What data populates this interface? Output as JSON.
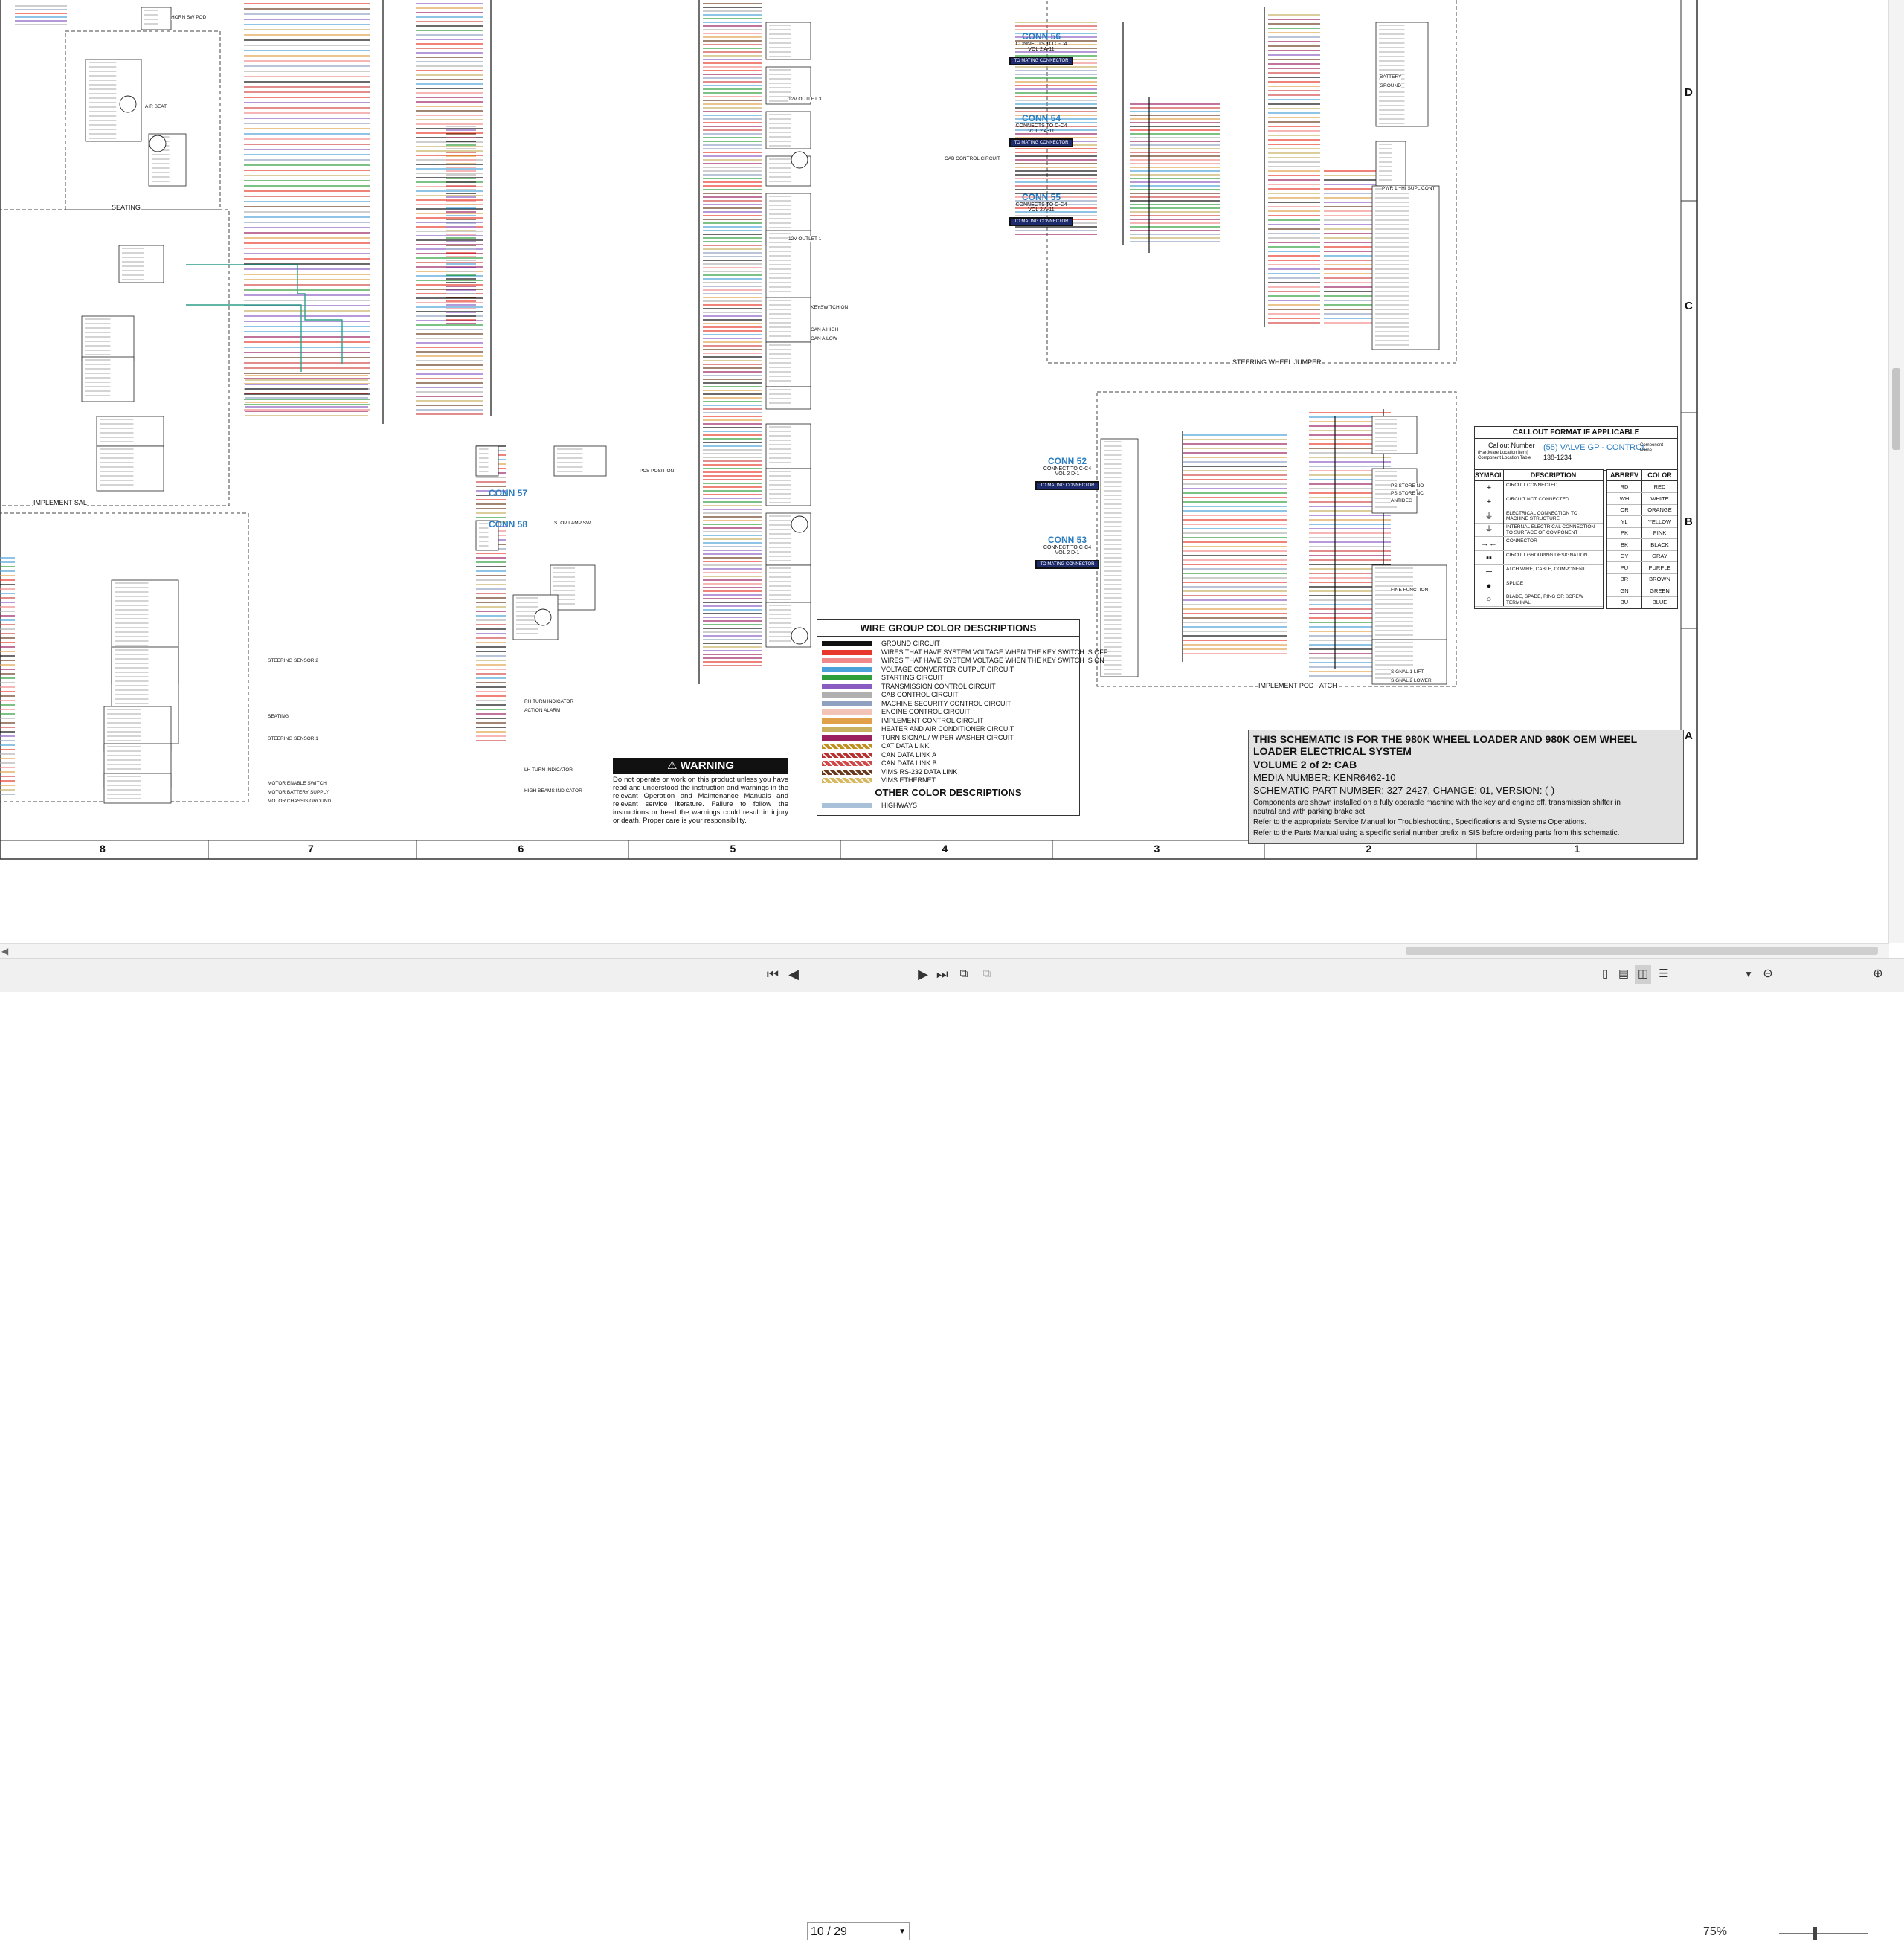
{
  "toolbar": {
    "page_current": "10",
    "page_total": "29",
    "page_display": "10 / 29",
    "zoom": "75%",
    "first_icon": "first-page-icon",
    "prev_icon": "previous-page-icon",
    "next_icon": "next-page-icon",
    "last_icon": "last-page-icon"
  },
  "connectors": [
    {
      "name": "CONN 56",
      "text": "CONNECTS TO C-C4",
      "vol": "VOL 2 A-11",
      "badge": "TO MATING CONNECTOR"
    },
    {
      "name": "CONN 54",
      "text": "CONNECTS TO C-C4",
      "vol": "VOL 2 A-11",
      "badge": "TO MATING CONNECTOR"
    },
    {
      "name": "CONN 55",
      "text": "CONNECTS TO C-C4",
      "vol": "VOL 2 A-11",
      "badge": "TO MATING CONNECTOR"
    },
    {
      "name": "CONN 52",
      "text": "CONNECT TO C-C4",
      "vol": "VOL 2 D-1",
      "badge": "TO MATING CONNECTOR"
    },
    {
      "name": "CONN 53",
      "text": "CONNECT TO C-C4",
      "vol": "VOL 2 D-1",
      "badge": "TO MATING CONNECTOR"
    },
    {
      "name": "CONN 57",
      "text": "",
      "vol": "",
      "badge": ""
    },
    {
      "name": "CONN 58",
      "text": "",
      "vol": "",
      "badge": ""
    }
  ],
  "section_labels": {
    "seating": "SEATING",
    "implement_sal": "IMPLEMENT SAL",
    "steering_wheel_jumper": "STEERING WHEEL JUMPER",
    "implement_pod": "IMPLEMENT POD - ATCH"
  },
  "wire_group": {
    "title": "WIRE GROUP COLOR DESCRIPTIONS",
    "rows": [
      {
        "label": "GROUND CIRCUIT",
        "color": "#111111"
      },
      {
        "label": "WIRES THAT HAVE SYSTEM VOLTAGE WHEN THE KEY SWITCH IS OFF",
        "color": "#e8382b"
      },
      {
        "label": "WIRES THAT HAVE SYSTEM VOLTAGE WHEN THE KEY SWITCH IS ON",
        "color": "#f08a8a"
      },
      {
        "label": "VOLTAGE CONVERTER OUTPUT CIRCUIT",
        "color": "#4aa0d8"
      },
      {
        "label": "STARTING CIRCUIT",
        "color": "#2e9e3a"
      },
      {
        "label": "TRANSMISSION CONTROL CIRCUIT",
        "color": "#8a5cc2"
      },
      {
        "label": "CAB CONTROL CIRCUIT",
        "color": "#b0b0b0"
      },
      {
        "label": "MACHINE SECURITY CONTROL CIRCUIT",
        "color": "#8fa0c0"
      },
      {
        "label": "ENGINE CONTROL CIRCUIT",
        "color": "#f2c4b8"
      },
      {
        "label": "IMPLEMENT CONTROL CIRCUIT",
        "color": "#e0a14a"
      },
      {
        "label": "HEATER AND AIR CONDITIONER CIRCUIT",
        "color": "#c8b060"
      },
      {
        "label": "TURN SIGNAL / WIPER WASHER CIRCUIT",
        "color": "#9a2060"
      },
      {
        "label": "CAT DATA LINK",
        "color": "#c09020"
      },
      {
        "label": "CAN DATA LINK A",
        "color": "#b83030"
      },
      {
        "label": "CAN DATA LINK B",
        "color": "#d04848"
      },
      {
        "label": "VIMS RS-232 DATA LINK",
        "color": "#6b3a1e"
      },
      {
        "label": "VIMS ETHERNET",
        "color": "#d8b860"
      }
    ],
    "other_title": "OTHER COLOR DESCRIPTIONS",
    "other_rows": [
      {
        "label": "HIGHWAYS",
        "color": "#a8c0d8"
      }
    ]
  },
  "warning": {
    "title": "WARNING",
    "text": "Do not operate or work on this product unless you have read and understood the instruction and warnings in the relevant Operation and Maintenance Manuals and relevant service literature. Failure to follow the instructions or heed the warnings could result in injury or death. Proper care is your responsibility."
  },
  "callout": {
    "title": "CALLOUT FORMAT IF APPLICABLE",
    "callout_number": "Callout Number",
    "callout_sub": "(Hardware Location Item) Component Location Table",
    "example": "(55) VALVE GP - CONTROL",
    "example_part": "138-1234",
    "component_name": "Component Name"
  },
  "symbols": {
    "header_symbol": "SYMBOL",
    "header_description": "DESCRIPTION",
    "rows": [
      {
        "glyph": "+",
        "desc": "CIRCUIT CONNECTED"
      },
      {
        "glyph": "+",
        "desc": "CIRCUIT NOT CONNECTED"
      },
      {
        "glyph": "⏚",
        "desc": "ELECTRICAL CONNECTION TO MACHINE STRUCTURE"
      },
      {
        "glyph": "⏚",
        "desc": "INTERNAL ELECTRICAL CONNECTION TO SURFACE OF COMPONENT"
      },
      {
        "glyph": "→←",
        "desc": "CONNECTOR"
      },
      {
        "glyph": "▪▪",
        "desc": "CIRCUIT GROUPING DESIGNATION"
      },
      {
        "glyph": "─",
        "desc": "ATCH WIRE, CABLE, COMPONENT"
      },
      {
        "glyph": "●",
        "desc": "SPLICE"
      },
      {
        "glyph": "○",
        "desc": "BLADE, SPADE, RING OR SCREW TERMINAL"
      }
    ]
  },
  "abbrev": {
    "header_abbrev": "ABBREV",
    "header_color": "COLOR",
    "rows": [
      {
        "abbrev": "RD",
        "color": "RED"
      },
      {
        "abbrev": "WH",
        "color": "WHITE"
      },
      {
        "abbrev": "OR",
        "color": "ORANGE"
      },
      {
        "abbrev": "YL",
        "color": "YELLOW"
      },
      {
        "abbrev": "PK",
        "color": "PINK"
      },
      {
        "abbrev": "BK",
        "color": "BLACK"
      },
      {
        "abbrev": "GY",
        "color": "GRAY"
      },
      {
        "abbrev": "PU",
        "color": "PURPLE"
      },
      {
        "abbrev": "BR",
        "color": "BROWN"
      },
      {
        "abbrev": "GN",
        "color": "GREEN"
      },
      {
        "abbrev": "BU",
        "color": "BLUE"
      }
    ]
  },
  "title_block": {
    "heading": "THIS SCHEMATIC IS FOR THE 980K WHEEL LOADER AND 980K OEM WHEEL LOADER ELECTRICAL SYSTEM",
    "volume": "VOLUME 2 of 2: CAB",
    "media": "MEDIA NUMBER: KENR6462-10",
    "part": "SCHEMATIC PART NUMBER: 327-2427, CHANGE: 01, VERSION: (-)",
    "note1": "Components are shown installed on a fully operable machine with the key and engine off, transmission shifter in neutral and with parking brake set.",
    "note2": "Refer to the appropriate Service Manual for Troubleshooting, Specifications and Systems Operations.",
    "note3": "Refer to the Parts Manual using a specific serial number prefix in SIS before ordering parts from this schematic."
  },
  "grid_columns": [
    "8",
    "7",
    "6",
    "5",
    "4",
    "3",
    "2",
    "1"
  ],
  "grid_rows": [
    "D",
    "C",
    "B",
    "A"
  ],
  "components": [
    "HORN SW POD",
    "AIR SEAT",
    "SEATING",
    "STEERING SENSOR 1",
    "MOTOR ENABLE SWITCH",
    "MOTOR BATTERY SUPPLY",
    "MOTOR CHASSIS GROUND",
    "PWR 1 +HI SUPL CONT",
    "STEERING SENSOR 2",
    "12V OUTLET 3",
    "12V OUTLET 1",
    "CAB CONTROL CIRCUIT",
    "HIGH BEAMS INDICATOR",
    "LH TURN INDICATOR",
    "RH TURN INDICATOR",
    "ACTION ALARM",
    "PCS POSITION",
    "STOP LAMP SW",
    "BATTERY",
    "GROUND",
    "KEYSWITCH ON",
    "CAN A HIGH",
    "CAN A LOW",
    "PS STORE NO",
    "PS STORE NC",
    "ANTIDEG",
    "FINE FUNCTION",
    "SIGNAL 1 LIFT",
    "SIGNAL 2 LOWER"
  ]
}
